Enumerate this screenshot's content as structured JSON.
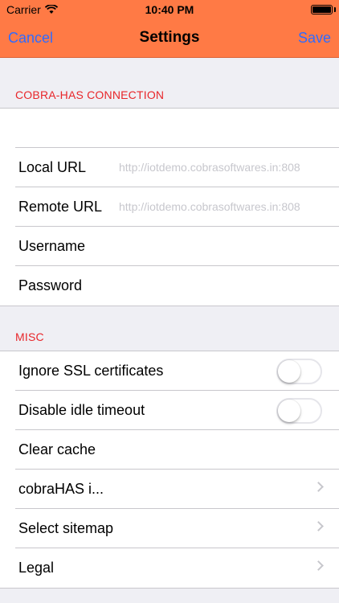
{
  "status_bar": {
    "carrier": "Carrier",
    "time": "10:40 PM"
  },
  "nav": {
    "left": "Cancel",
    "title": "Settings",
    "right": "Save"
  },
  "sections": [
    {
      "header": "COBRA-HAS CONNECTION",
      "rows": [
        {
          "label": "",
          "value": ""
        },
        {
          "label": "Local URL",
          "value": "http://iotdemo.cobrasoftwares.in:808"
        },
        {
          "label": "Remote URL",
          "value": "http://iotdemo.cobrasoftwares.in:808"
        },
        {
          "label": "Username",
          "value": ""
        },
        {
          "label": "Password",
          "value": ""
        }
      ]
    },
    {
      "header": "MISC",
      "rows": [
        {
          "label": "Ignore SSL certificates"
        },
        {
          "label": "Disable idle timeout"
        },
        {
          "label": "Clear cache"
        },
        {
          "label": "cobraHAS i..."
        },
        {
          "label": "Select sitemap"
        },
        {
          "label": "Legal"
        }
      ]
    }
  ],
  "colors": {
    "nav_background": "#ff7a45",
    "nav_button": "#2f6bff",
    "section_header": "#e8262a"
  }
}
